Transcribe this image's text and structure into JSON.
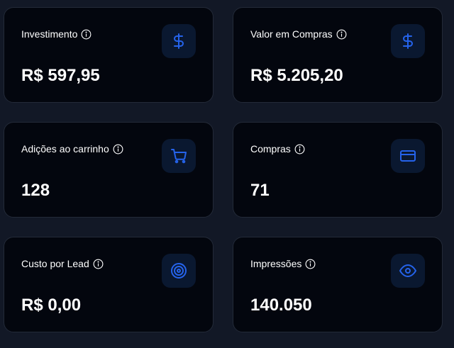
{
  "cards": [
    {
      "label": "Investimento",
      "value": "R$ 597,95",
      "icon": "dollar-icon"
    },
    {
      "label": "Valor em Compras",
      "value": "R$ 5.205,20",
      "icon": "dollar-icon"
    },
    {
      "label": "Adições ao carrinho",
      "value": "128",
      "icon": "cart-icon"
    },
    {
      "label": "Compras",
      "value": "71",
      "icon": "credit-card-icon"
    },
    {
      "label": "Custo por Lead",
      "value": "R$ 0,00",
      "icon": "target-icon"
    },
    {
      "label": "Impressões",
      "value": "140.050",
      "icon": "eye-icon"
    }
  ],
  "colors": {
    "background": "#121826",
    "card": "#03060e",
    "card_border": "#232a38",
    "icon_accent": "#2563eb",
    "icon_bg": "#0a1830"
  }
}
